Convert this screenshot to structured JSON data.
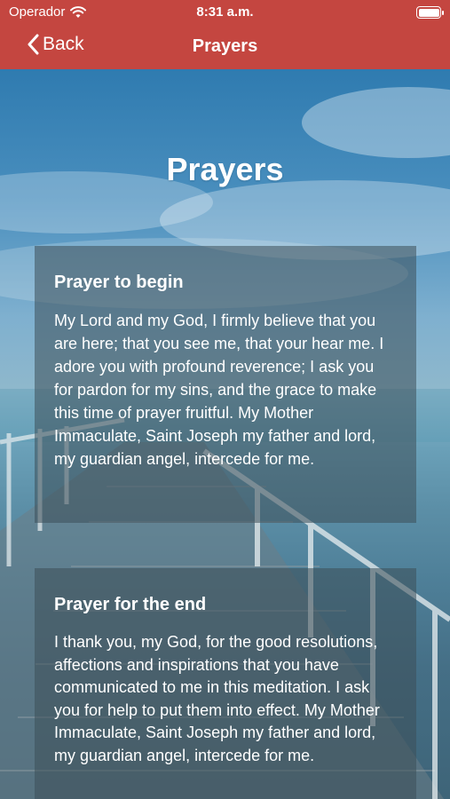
{
  "status_bar": {
    "carrier": "Operador",
    "time": "8:31 a.m."
  },
  "nav": {
    "back_label": "Back",
    "title": "Prayers"
  },
  "page": {
    "heading": "Prayers"
  },
  "cards": [
    {
      "title": "Prayer to begin",
      "body": "My Lord and my God, I firmly believe that you are here; that you see me, that your hear me. I adore you with profound reverence; I ask you for pardon for my sins, and the grace to make this time of prayer fruitful. My Mother Immaculate, Saint Joseph my father and lord, my guardian angel, intercede for me."
    },
    {
      "title": "Prayer for the end",
      "body": "I thank you, my God, for the good resolutions, affections and inspirations that you have communicated to me in this meditation. I ask you for help to put them into effect. My Mother Immaculate, Saint Joseph my father and lord, my guardian angel, intercede for me."
    }
  ],
  "colors": {
    "header_red": "#c44640",
    "card_overlay": "rgba(60, 78, 88, 0.55)"
  }
}
